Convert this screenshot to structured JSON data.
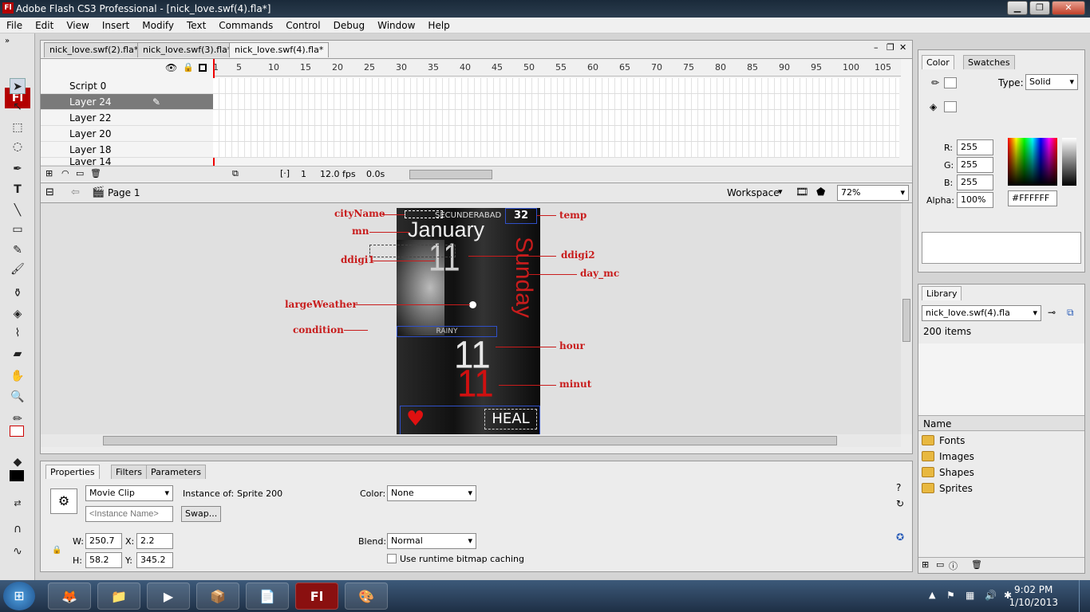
{
  "window": {
    "title": "Adobe Flash CS3 Professional - [nick_love.swf(4).fla*]",
    "app_icon": "Fl"
  },
  "menu": [
    "File",
    "Edit",
    "View",
    "Insert",
    "Modify",
    "Text",
    "Commands",
    "Control",
    "Debug",
    "Window",
    "Help"
  ],
  "doc_tabs": [
    {
      "label": "nick_love.swf(2).fla*"
    },
    {
      "label": "nick_love.swf(3).fla*"
    },
    {
      "label": "nick_love.swf(4).fla*"
    }
  ],
  "timeline": {
    "ruler": [
      "1",
      "5",
      "10",
      "15",
      "20",
      "25",
      "30",
      "35",
      "40",
      "45",
      "50",
      "55",
      "60",
      "65",
      "70",
      "75",
      "80",
      "85",
      "90",
      "95",
      "100",
      "105"
    ],
    "layers": [
      {
        "name": "Script 0"
      },
      {
        "name": "Layer 24"
      },
      {
        "name": "Layer 22"
      },
      {
        "name": "Layer 20"
      },
      {
        "name": "Layer 18"
      },
      {
        "name": "Layer 14"
      }
    ],
    "current_frame": "1",
    "fps": "12.0 fps",
    "time": "0.0s"
  },
  "editbar": {
    "scene": "Page 1",
    "workspace": "Workspace",
    "zoom": "72%"
  },
  "stage": {
    "city": "SECUNDERABAD",
    "temp_value": "32",
    "month": "January",
    "date": "11",
    "day": "Sunday",
    "condition_text": "RAINY",
    "hour": "11",
    "minute": "11",
    "bottom_text": "HEAL",
    "labels": {
      "cityName": "cityName",
      "temp": "temp",
      "mn": "mn",
      "ddigi1": "ddigi1",
      "ddigi2": "ddigi2",
      "day_mc": "day_mc",
      "largeWeather": "largeWeather",
      "condition": "condition",
      "hour": "hour",
      "minut": "minut"
    }
  },
  "properties": {
    "tabs": [
      "Properties",
      "Filters",
      "Parameters"
    ],
    "symbol_type": "Movie Clip",
    "instance_of_label": "Instance of:",
    "instance_of": "Sprite 200",
    "instance_name_placeholder": "<Instance Name>",
    "swap_label": "Swap...",
    "color_label": "Color:",
    "color_value": "None",
    "blend_label": "Blend:",
    "blend_value": "Normal",
    "cache_label": "Use runtime bitmap caching",
    "w_label": "W:",
    "w": "250.7",
    "h_label": "H:",
    "h": "58.2",
    "x_label": "X:",
    "x": "2.2",
    "y_label": "Y:",
    "y": "345.2"
  },
  "color_panel": {
    "tabs": [
      "Color",
      "Swatches"
    ],
    "type_label": "Type:",
    "type": "Solid",
    "r_label": "R:",
    "r": "255",
    "g_label": "G:",
    "g": "255",
    "b_label": "B:",
    "b": "255",
    "alpha_label": "Alpha:",
    "alpha": "100%",
    "hex": "#FFFFFF"
  },
  "library_panel": {
    "tab": "Library",
    "file": "nick_love.swf(4).fla",
    "count": "200 items",
    "name_header": "Name",
    "items": [
      "Fonts",
      "Images",
      "Shapes",
      "Sprites"
    ]
  },
  "taskbar": {
    "time": "9:02 PM",
    "date": "1/10/2013"
  },
  "colors": {
    "accent_red": "#c81c1c",
    "flash_red": "#b30000",
    "layer_color": "#4a6fd8"
  }
}
